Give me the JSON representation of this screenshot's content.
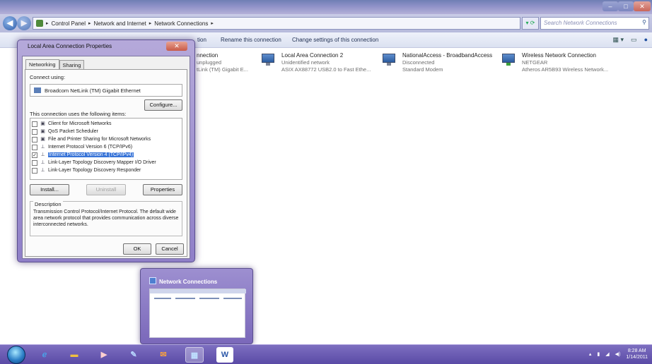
{
  "explorer": {
    "breadcrumb": [
      "Control Panel",
      "Network and Internet",
      "Network Connections"
    ],
    "search_placeholder": "Search Network Connections",
    "commands": {
      "partial_left": "tion",
      "rename": "Rename this connection",
      "change_settings": "Change settings of this connection"
    }
  },
  "connections": [
    {
      "name": "nnection",
      "status": "unplugged",
      "device": "tLink (TM) Gigabit E..."
    },
    {
      "name": "Local Area Connection 2",
      "status": "Unidentified network",
      "device": "ASIX AX88772 USB2.0 to Fast Ethe..."
    },
    {
      "name": "NationalAccess - BroadbandAccess",
      "status": "Disconnected",
      "device": "Standard Modem"
    },
    {
      "name": "Wireless Network Connection",
      "status": "NETGEAR",
      "device": "Atheros AR5B93 Wireless Network..."
    }
  ],
  "dialog": {
    "title": "Local Area Connection Properties",
    "tabs": [
      "Networking",
      "Sharing"
    ],
    "connect_using_label": "Connect using:",
    "adapter": "Broadcom NetLink (TM) Gigabit Ethernet",
    "configure": "Configure...",
    "items_label": "This connection uses the following items:",
    "items": [
      {
        "label": "Client for Microsoft Networks",
        "checked": false,
        "selected": false
      },
      {
        "label": "QoS Packet Scheduler",
        "checked": false,
        "selected": false
      },
      {
        "label": "File and Printer Sharing for Microsoft Networks",
        "checked": false,
        "selected": false
      },
      {
        "label": "Internet Protocol Version 6 (TCP/IPv6)",
        "checked": false,
        "selected": false
      },
      {
        "label": "Internet Protocol Version 4 (TCP/IPv4)",
        "checked": true,
        "selected": true
      },
      {
        "label": "Link-Layer Topology Discovery Mapper I/O Driver",
        "checked": false,
        "selected": false
      },
      {
        "label": "Link-Layer Topology Discovery Responder",
        "checked": false,
        "selected": false
      }
    ],
    "install": "Install...",
    "uninstall": "Uninstall",
    "properties": "Properties",
    "description_label": "Description",
    "description": "Transmission Control Protocol/Internet Protocol. The default wide area network protocol that provides communication across diverse interconnected networks.",
    "ok": "OK",
    "cancel": "Cancel"
  },
  "preview": {
    "title": "Network Connections"
  },
  "taskbar": {
    "time": "8:28 AM",
    "date": "1/14/2011",
    "word_letter": "W"
  }
}
